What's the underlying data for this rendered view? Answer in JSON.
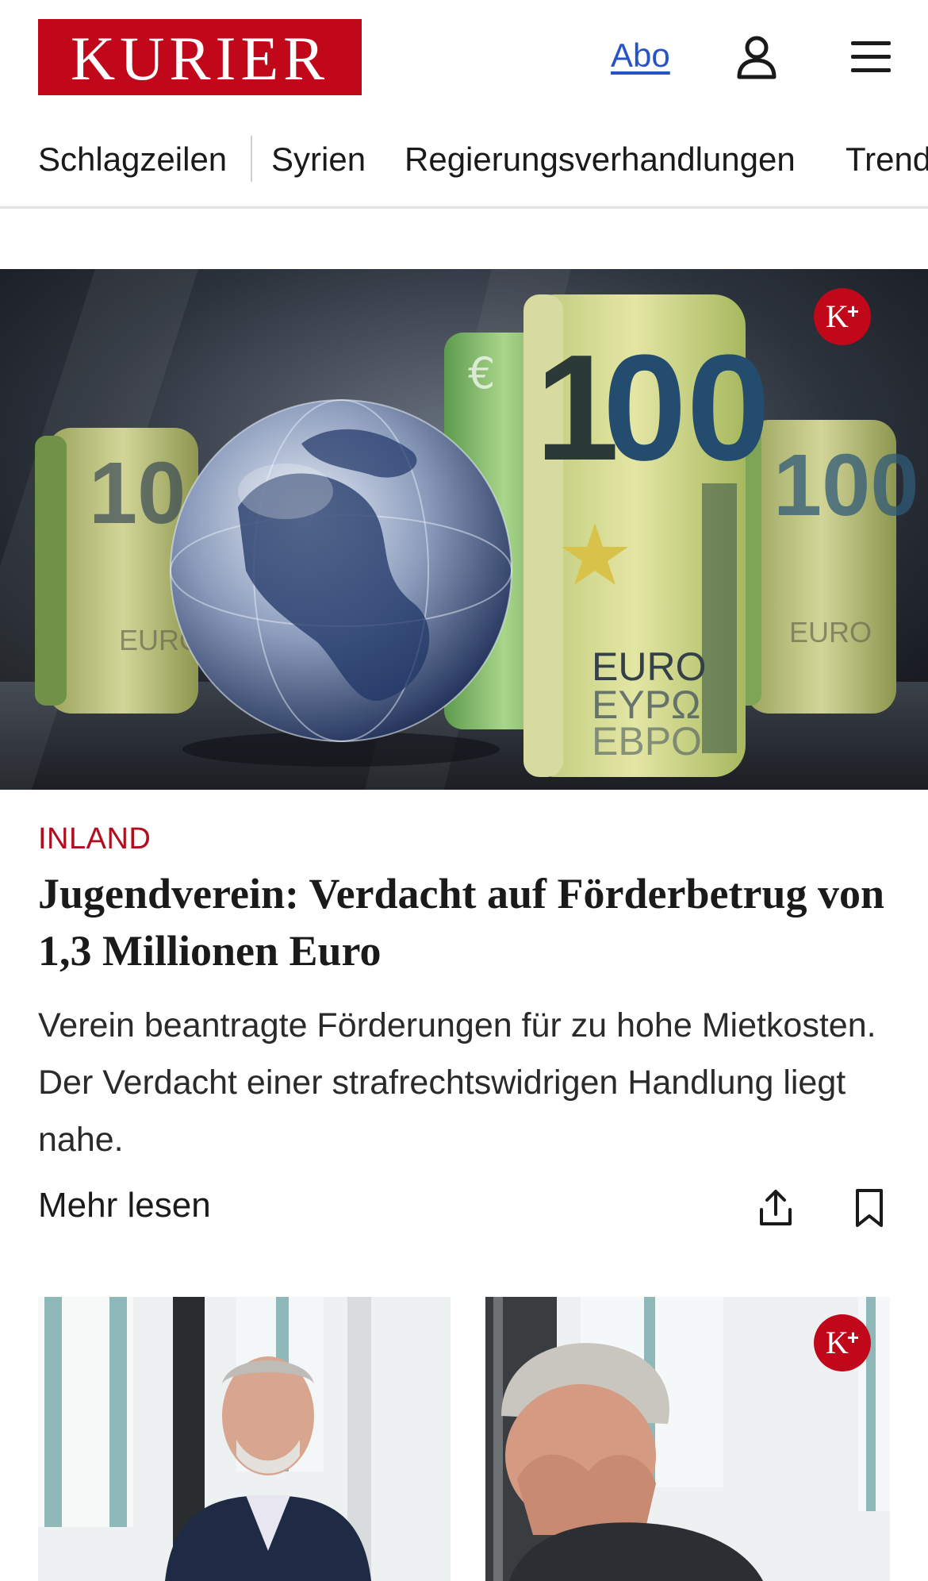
{
  "header": {
    "logo_text": "KURIER",
    "abo_label": "Abo",
    "user_icon": "user-icon",
    "menu_icon": "hamburger-menu-icon"
  },
  "nav": {
    "items": [
      {
        "label": "Schlagzeilen"
      },
      {
        "label": "Syrien"
      },
      {
        "label": "Regierungsverhandlungen"
      },
      {
        "label": "Trends"
      }
    ]
  },
  "hero_article": {
    "badge": "K+",
    "section": "INLAND",
    "headline": "Jugendverein: Verdacht auf Förderbetrug von 1,3 Millionen Euro",
    "teaser": "Verein beantragte Förderungen für zu hohe Mietkosten. Der Verdacht einer strafrechtswidrigen Handlung liegt nahe.",
    "more_label": "Mehr lesen",
    "share_icon": "share-icon",
    "bookmark_icon": "bookmark-icon"
  },
  "cards": [
    {
      "image": "man-portrait-photo"
    },
    {
      "image": "man-covering-face-photo",
      "badge": "K+"
    }
  ],
  "colors": {
    "brand_red": "#c0081a",
    "section_red": "#b00d1e",
    "link_blue": "#2754c5"
  }
}
